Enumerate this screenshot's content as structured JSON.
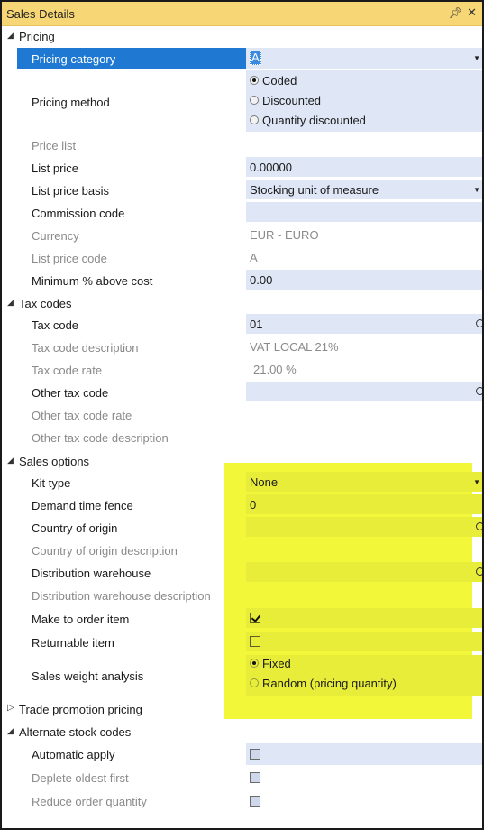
{
  "window": {
    "title": "Sales Details",
    "pin_icon": "pin-icon",
    "close_icon": "close-icon"
  },
  "sections": {
    "pricing": "Pricing",
    "tax_codes": "Tax codes",
    "sales_options": "Sales options",
    "trade_promotion": "Trade promotion pricing",
    "alternate_stock": "Alternate stock codes"
  },
  "pricing": {
    "pricing_category": {
      "label": "Pricing category",
      "value": "A"
    },
    "pricing_method": {
      "label": "Pricing method",
      "options": [
        "Coded",
        "Discounted",
        "Quantity discounted"
      ],
      "selected": "Coded"
    },
    "price_list": {
      "label": "Price list",
      "value": ""
    },
    "list_price": {
      "label": "List price",
      "value": "0.00000"
    },
    "list_price_basis": {
      "label": "List price basis",
      "value": "Stocking unit of measure"
    },
    "commission_code": {
      "label": "Commission code",
      "value": ""
    },
    "currency": {
      "label": "Currency",
      "value": "EUR - EURO"
    },
    "list_price_code": {
      "label": "List price code",
      "value": "A"
    },
    "minimum_above_cost": {
      "label": "Minimum % above cost",
      "value": "0.00"
    }
  },
  "tax": {
    "tax_code": {
      "label": "Tax code",
      "value": "01"
    },
    "tax_code_description": {
      "label": "Tax code description",
      "value": "VAT LOCAL 21%"
    },
    "tax_code_rate": {
      "label": "Tax code rate",
      "value": "21.00 %"
    },
    "other_tax_code": {
      "label": "Other tax code",
      "value": ""
    },
    "other_tax_code_rate": {
      "label": "Other tax code rate",
      "value": ""
    },
    "other_tax_code_description": {
      "label": "Other tax code description",
      "value": ""
    }
  },
  "sales_options": {
    "kit_type": {
      "label": "Kit type",
      "value": "None"
    },
    "demand_time_fence": {
      "label": "Demand time fence",
      "value": "0"
    },
    "country_of_origin": {
      "label": "Country of origin",
      "value": ""
    },
    "country_of_origin_description": {
      "label": "Country of origin description",
      "value": ""
    },
    "distribution_warehouse": {
      "label": "Distribution warehouse",
      "value": ""
    },
    "distribution_warehouse_description": {
      "label": "Distribution warehouse description",
      "value": ""
    },
    "make_to_order_item": {
      "label": "Make to order item",
      "checked": true
    },
    "returnable_item": {
      "label": "Returnable item",
      "checked": false
    },
    "sales_weight_analysis": {
      "label": "Sales weight analysis",
      "options": [
        "Fixed",
        "Random (pricing quantity)"
      ],
      "selected": "Fixed"
    }
  },
  "alternate_stock": {
    "automatic_apply": {
      "label": "Automatic apply",
      "checked": false
    },
    "deplete_oldest_first": {
      "label": "Deplete oldest first",
      "checked": false
    },
    "reduce_order_quantity": {
      "label": "Reduce order quantity",
      "checked": false
    }
  },
  "colors": {
    "titlebar": "#f7d775",
    "selection": "#1f78d2",
    "field": "#dfe7f7",
    "highlight": "#f2f73a"
  }
}
